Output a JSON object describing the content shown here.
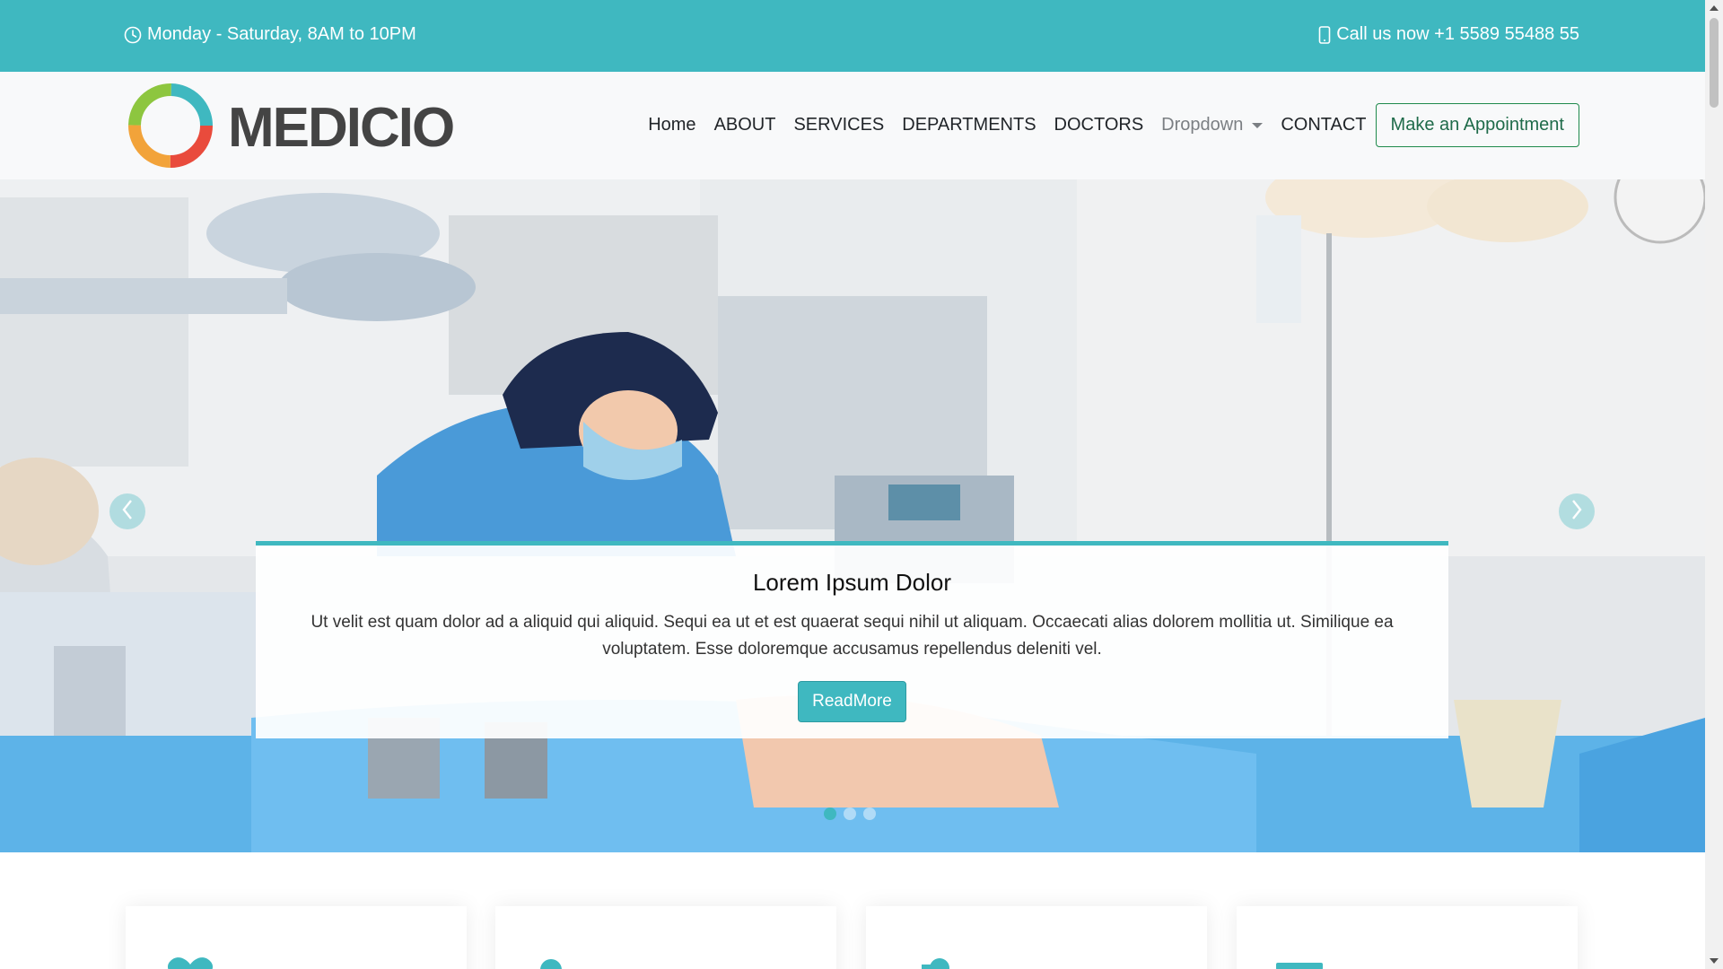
{
  "topbar": {
    "hours": "Monday - Saturday, 8AM to 10PM",
    "phone": "Call us now +1 5589 55488 55",
    "hours_icon": "clock-icon",
    "phone_icon": "phone-icon"
  },
  "header": {
    "logo_text": "MEDICIO",
    "nav": [
      {
        "label": "Home"
      },
      {
        "label": "ABOUT"
      },
      {
        "label": "SERVICES"
      },
      {
        "label": "DEPARTMENTS"
      },
      {
        "label": "DOCTORS"
      },
      {
        "label": "Dropdown"
      },
      {
        "label": "CONTACT"
      }
    ],
    "cta_label": "Make an Appointment"
  },
  "hero": {
    "title": "Lorem Ipsum Dolor",
    "text": "Ut velit est quam dolor ad a aliquid qui aliquid. Sequi ea ut et est quaerat sequi nihil ut aliquam. Occaecati alias dolorem mollitia ut. Similique ea voluptatem. Esse doloremque accusamus repellendus deleniti vel.",
    "button_label": "ReadMore",
    "slide_count": 3,
    "active_slide": 1,
    "prev_icon": "chevron-left-icon",
    "next_icon": "chevron-right-icon"
  },
  "cards": [
    {
      "icon": "heart-icon"
    },
    {
      "icon": "pill-icon"
    },
    {
      "icon": "hospital-user-icon"
    },
    {
      "icon": "dna-icon"
    }
  ],
  "colors": {
    "accent": "#3fb8c0",
    "cta_border": "#1f8a4c",
    "header_bg": "#f8f9fa"
  }
}
